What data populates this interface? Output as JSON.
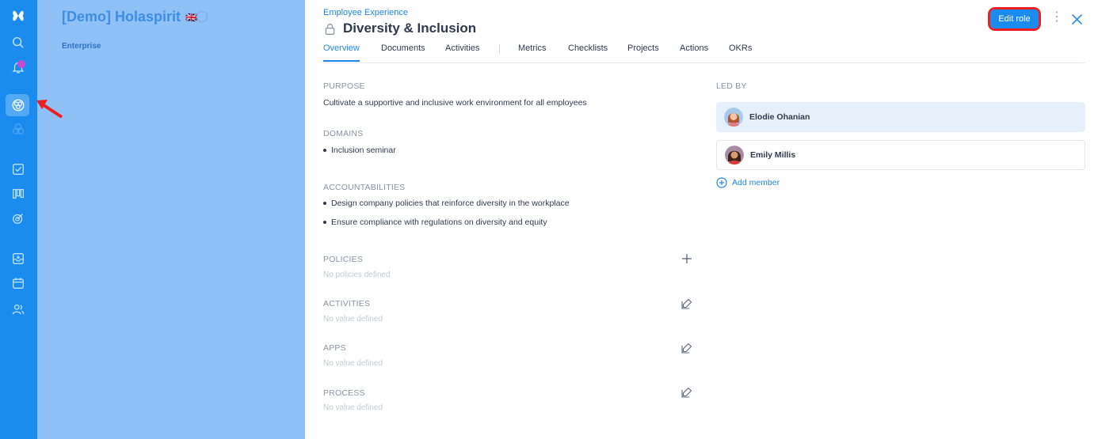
{
  "sidebar_icons": [
    "logo-icon",
    "search-icon",
    "bell-icon",
    "circles-icon",
    "roles-icon",
    "check-icon",
    "kanban-icon",
    "target-icon",
    "inbox-icon",
    "calendar-icon",
    "people-icon"
  ],
  "org": {
    "title": "[Demo] Holaspirit",
    "flag": "🇬🇧",
    "subtitle": "Enterprise"
  },
  "breadcrumb": "Employee Experience",
  "role_title": "Diversity & Inclusion",
  "edit_button": "Edit role",
  "tabs": [
    "Overview",
    "Documents",
    "Activities",
    "Metrics",
    "Checklists",
    "Projects",
    "Actions",
    "OKRs"
  ],
  "purpose": {
    "label": "PURPOSE",
    "text": "Cultivate a supportive and inclusive work environment for all employees"
  },
  "domains": {
    "label": "DOMAINS",
    "items": [
      "Inclusion seminar"
    ]
  },
  "accountabilities": {
    "label": "ACCOUNTABILITIES",
    "items": [
      "Design company policies that reinforce diversity in the workplace",
      "Ensure compliance with regulations on diversity and equity"
    ]
  },
  "policies": {
    "label": "POLICIES",
    "empty": "No policies defined"
  },
  "activities": {
    "label": "ACTIVITIES",
    "empty": "No value defined"
  },
  "apps": {
    "label": "APPS",
    "empty": "No value defined"
  },
  "process": {
    "label": "PROCESS",
    "empty": "No value defined"
  },
  "led_by": {
    "label": "LED BY",
    "members": [
      "Elodie Ohanian",
      "Emily Millis"
    ],
    "add_label": "Add member"
  },
  "colors": {
    "accent": "#1a8cf0",
    "highlight": "#ef1f1f"
  }
}
